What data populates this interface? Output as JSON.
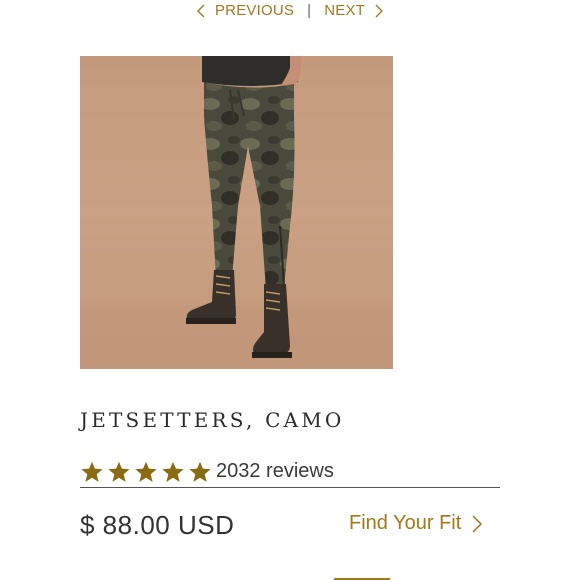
{
  "pager": {
    "previous_label": "PREVIOUS",
    "separator": "|",
    "next_label": "NEXT"
  },
  "product": {
    "title": "JETSETTERS, CAMO",
    "rating_stars": 5,
    "reviews_label": "2032 reviews",
    "price": "$ 88.00 USD",
    "find_fit_label": "Find Your Fit"
  },
  "colors": {
    "accent": "#a07a1c",
    "star": "#8a6a12",
    "image_bg": "#c79c7f"
  },
  "icons": {
    "previous": "chevron-left-icon",
    "next": "chevron-right-icon",
    "star": "star-icon",
    "fit": "chevron-right-icon"
  }
}
